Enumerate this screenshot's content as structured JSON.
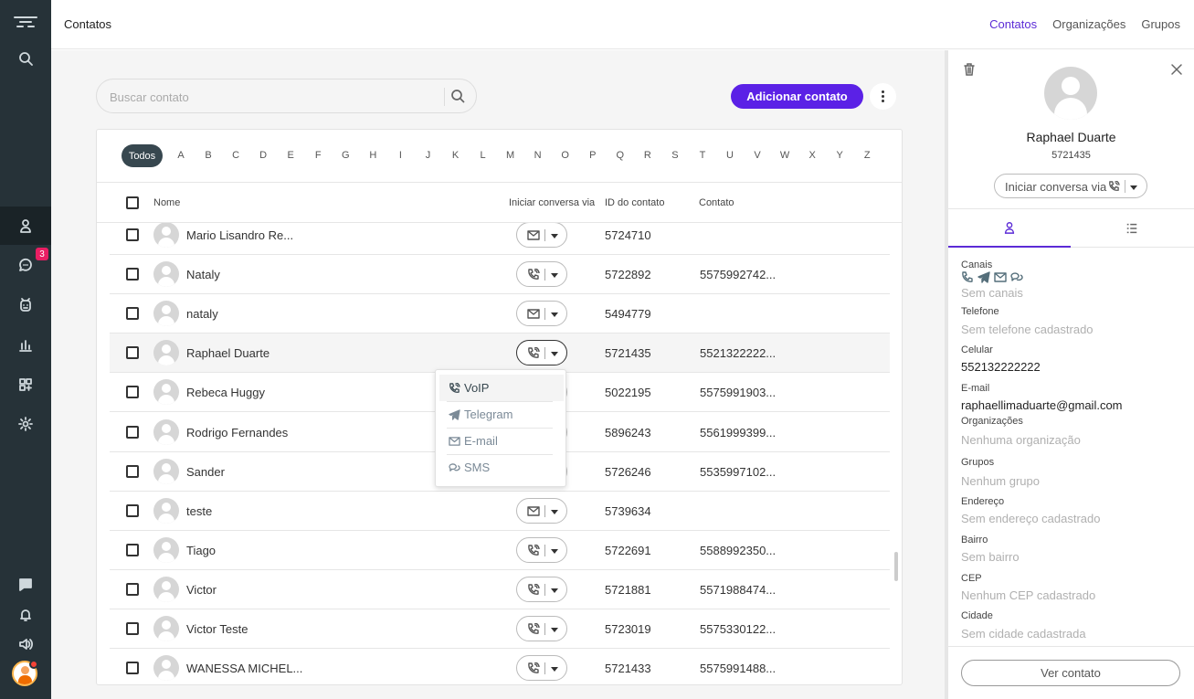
{
  "topbar": {
    "title": "Contatos",
    "nav": [
      "Contatos",
      "Organizações",
      "Grupos"
    ]
  },
  "sidebar": {
    "chat_badge": "3",
    "icons": [
      "menu-logo-icon",
      "search-icon",
      "contacts-icon",
      "chat-icon",
      "bot-icon",
      "reports-icon",
      "apps-icon",
      "settings-icon",
      "messages-icon",
      "bell-icon",
      "volume-icon",
      "user-avatar"
    ]
  },
  "search": {
    "placeholder": "Buscar contato"
  },
  "actions": {
    "add_contact": "Adicionar contato"
  },
  "alphabet": {
    "all": "Todos",
    "letters": [
      "A",
      "B",
      "C",
      "D",
      "E",
      "F",
      "G",
      "H",
      "I",
      "J",
      "K",
      "L",
      "M",
      "N",
      "O",
      "P",
      "Q",
      "R",
      "S",
      "T",
      "U",
      "V",
      "W",
      "X",
      "Y",
      "Z"
    ]
  },
  "table": {
    "headers": {
      "name": "Nome",
      "start_via": "Iniciar conversa via",
      "contact_id": "ID do contato",
      "contact": "Contato"
    },
    "rows": [
      {
        "name": "Mario Lisandro Re...",
        "channel": "email",
        "id": "5724710",
        "contact": ""
      },
      {
        "name": "Nataly",
        "channel": "phone",
        "id": "5722892",
        "contact": "5575992742..."
      },
      {
        "name": "nataly",
        "channel": "email",
        "id": "5494779",
        "contact": ""
      },
      {
        "name": "Raphael Duarte",
        "channel": "phone",
        "id": "5721435",
        "contact": "5521322222...",
        "selected": true
      },
      {
        "name": "Rebeca Huggy",
        "channel": "phone",
        "id": "5022195",
        "contact": "5575991903..."
      },
      {
        "name": "Rodrigo Fernandes",
        "channel": "phone",
        "id": "5896243",
        "contact": "5561999399..."
      },
      {
        "name": "Sander",
        "channel": "phone",
        "id": "5726246",
        "contact": "5535997102..."
      },
      {
        "name": "teste",
        "channel": "email",
        "id": "5739634",
        "contact": ""
      },
      {
        "name": "Tiago",
        "channel": "phone",
        "id": "5722691",
        "contact": "5588992350..."
      },
      {
        "name": "Victor",
        "channel": "phone",
        "id": "5721881",
        "contact": "5571988474..."
      },
      {
        "name": "Victor Teste",
        "channel": "phone",
        "id": "5723019",
        "contact": "5575330122..."
      },
      {
        "name": "WANESSA MICHEL...",
        "channel": "phone",
        "id": "5721433",
        "contact": "5575991488..."
      }
    ]
  },
  "dropdown": {
    "items": [
      {
        "label": "VoIP",
        "icon": "phone-icon"
      },
      {
        "label": "Telegram",
        "icon": "telegram-icon"
      },
      {
        "label": "E-mail",
        "icon": "email-icon"
      },
      {
        "label": "SMS",
        "icon": "sms-icon"
      }
    ]
  },
  "detail": {
    "name": "Raphael Duarte",
    "id": "5721435",
    "start_conversation": "Iniciar conversa via",
    "fields": {
      "canais_label": "Canais",
      "canais_value": "Sem canais",
      "telefone_label": "Telefone",
      "telefone_value": "Sem telefone cadastrado",
      "celular_label": "Celular",
      "celular_value": "552132222222",
      "email_label": "E-mail",
      "email_value": "raphaellimaduarte@gmail.com",
      "org_label": "Organizações",
      "org_value": "Nenhuma organização",
      "grupos_label": "Grupos",
      "grupos_value": "Nenhum grupo",
      "endereco_label": "Endereço",
      "endereco_value": "Sem endereço cadastrado",
      "bairro_label": "Bairro",
      "bairro_value": "Sem bairro",
      "cep_label": "CEP",
      "cep_value": "Nenhum CEP cadastrado",
      "cidade_label": "Cidade",
      "cidade_value": "Sem cidade cadastrada"
    },
    "view_contact": "Ver contato"
  },
  "colors": {
    "accent": "#5b21e6",
    "sidebar": "#263238",
    "badge": "#e91e63"
  }
}
